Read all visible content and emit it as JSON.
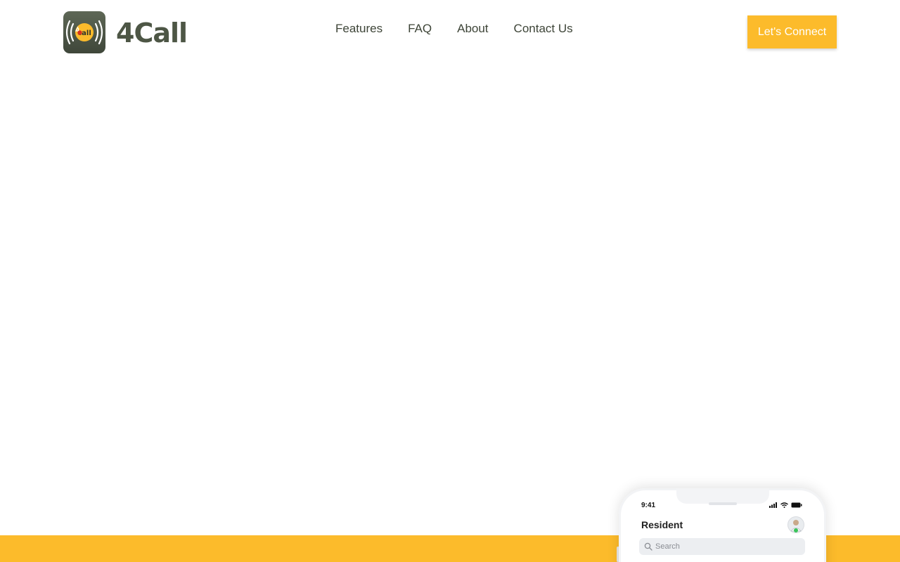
{
  "brand": {
    "name": "4Call",
    "logo_icon": "4call-logo-icon",
    "logo_text_color": "#4d5645"
  },
  "nav": {
    "items": [
      {
        "label": "Features"
      },
      {
        "label": "FAQ"
      },
      {
        "label": "About"
      },
      {
        "label": "Contact Us"
      }
    ]
  },
  "cta": {
    "label": "Let's Connect",
    "color": "#fcbb2b"
  },
  "accent_color": "#fcbb2b",
  "phone": {
    "time": "9:41",
    "title": "Resident",
    "search_placeholder": "Search",
    "icons": [
      "signal-icon",
      "wifi-icon",
      "battery-icon",
      "search-icon",
      "avatar"
    ]
  }
}
